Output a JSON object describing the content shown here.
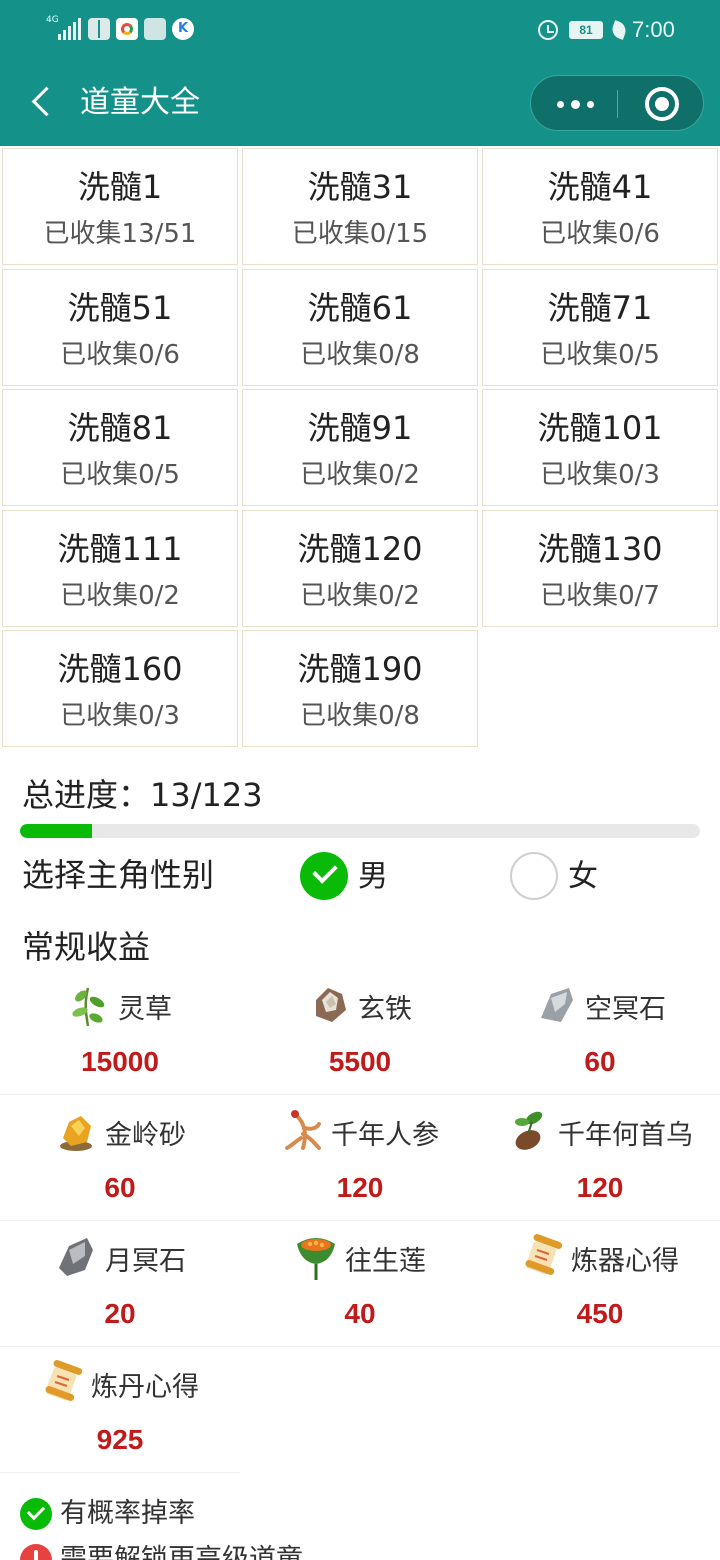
{
  "status_bar": {
    "network": "4G",
    "battery": "81",
    "time": "7:00"
  },
  "header": {
    "title": "道童大全",
    "menu_icon": "more-dots-icon",
    "close_icon": "target-circle-icon"
  },
  "tiers": [
    {
      "name": "洗髓1",
      "progress": "已收集13/51"
    },
    {
      "name": "洗髓31",
      "progress": "已收集0/15"
    },
    {
      "name": "洗髓41",
      "progress": "已收集0/6"
    },
    {
      "name": "洗髓51",
      "progress": "已收集0/6"
    },
    {
      "name": "洗髓61",
      "progress": "已收集0/8"
    },
    {
      "name": "洗髓71",
      "progress": "已收集0/5"
    },
    {
      "name": "洗髓81",
      "progress": "已收集0/5"
    },
    {
      "name": "洗髓91",
      "progress": "已收集0/2"
    },
    {
      "name": "洗髓101",
      "progress": "已收集0/3"
    },
    {
      "name": "洗髓111",
      "progress": "已收集0/2"
    },
    {
      "name": "洗髓120",
      "progress": "已收集0/2"
    },
    {
      "name": "洗髓130",
      "progress": "已收集0/7"
    },
    {
      "name": "洗髓160",
      "progress": "已收集0/3"
    },
    {
      "name": "洗髓190",
      "progress": "已收集0/8"
    }
  ],
  "total": {
    "label": "总进度：13/123",
    "fraction": 0.106
  },
  "gender": {
    "label": "选择主角性别",
    "male": "男",
    "female": "女",
    "selected": "男"
  },
  "rewards": {
    "title": "常规收益",
    "items": [
      {
        "name": "灵草",
        "value": "15000",
        "icon": "herb-icon"
      },
      {
        "name": "玄铁",
        "value": "5500",
        "icon": "iron-ore-icon"
      },
      {
        "name": "空冥石",
        "value": "60",
        "icon": "grey-stone-icon"
      },
      {
        "name": "金岭砂",
        "value": "60",
        "icon": "gold-sand-icon"
      },
      {
        "name": "千年人参",
        "value": "120",
        "icon": "ginseng-icon"
      },
      {
        "name": "千年何首乌",
        "value": "120",
        "icon": "fleeceflower-root-icon"
      },
      {
        "name": "月冥石",
        "value": "20",
        "icon": "moon-stone-icon"
      },
      {
        "name": "往生莲",
        "value": "40",
        "icon": "lotus-pod-icon"
      },
      {
        "name": "炼器心得",
        "value": "450",
        "icon": "scroll-icon"
      },
      {
        "name": "炼丹心得",
        "value": "925",
        "icon": "scroll-icon"
      }
    ]
  },
  "legend": {
    "drop": "有概率掉率",
    "locked": "需要解锁更高级道童"
  },
  "colors": {
    "header": "#14928a",
    "accent_green": "#09bb07",
    "value_red": "#c01a1a",
    "warn_red": "#e64340"
  }
}
